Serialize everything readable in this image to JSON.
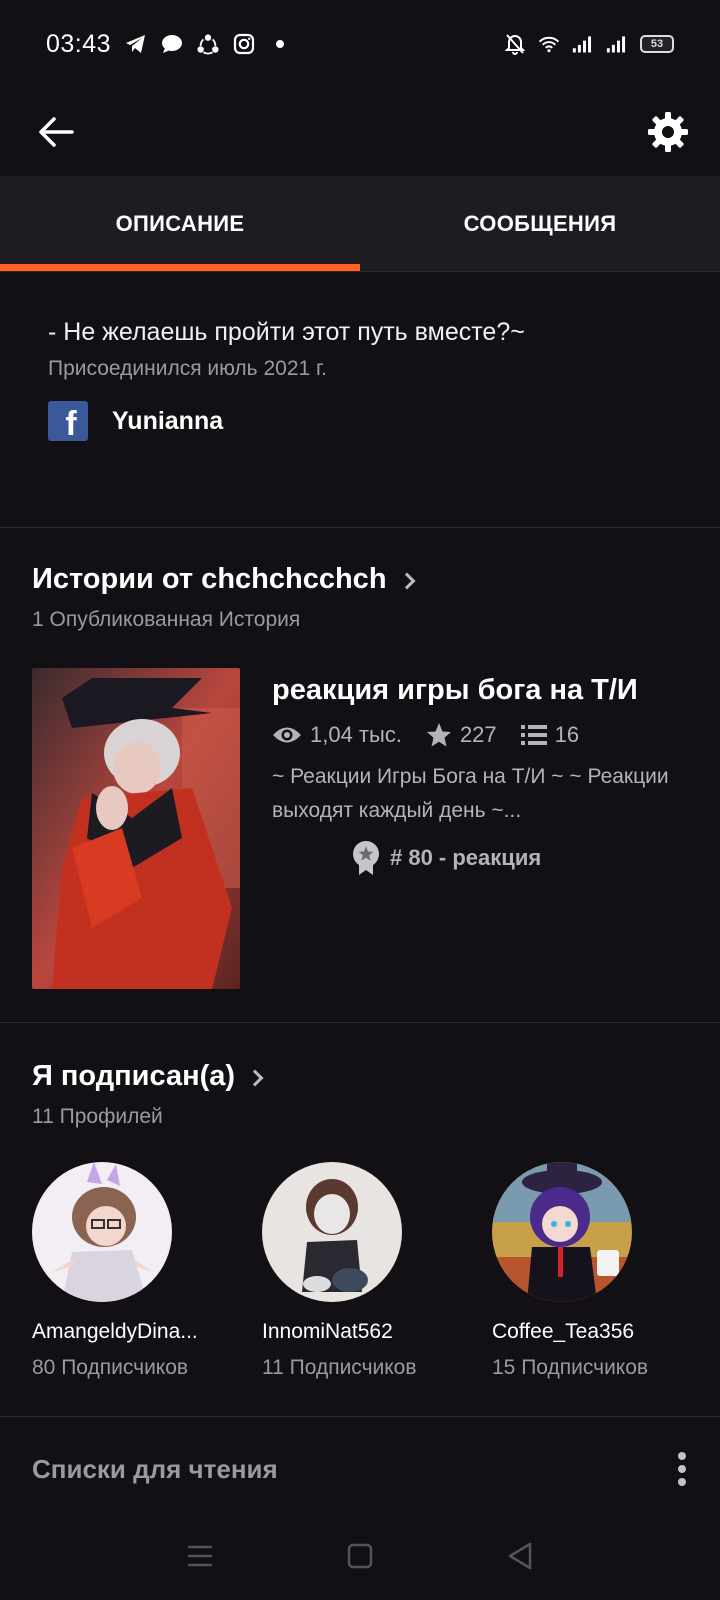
{
  "status_bar": {
    "time": "03:43",
    "battery": "53"
  },
  "tabs": [
    {
      "label": "ОПИСАНИЕ",
      "active": true
    },
    {
      "label": "СООБЩЕНИЯ",
      "active": false
    }
  ],
  "about": {
    "tagline": "- Не желаешь пройти этот путь вместе?~",
    "joined": "Присоединился июль 2021 г.",
    "facebook_name": "Yunianna"
  },
  "stories_section": {
    "title": "Истории от chchchcchch",
    "subtitle": "1 Опубликованная История",
    "story": {
      "title": "реакция игры бога на Т/И",
      "reads": "1,04 тыс.",
      "votes": "227",
      "parts": "16",
      "description": "~ Реакции Игры Бога на Т/И ~ ~ Реакции выходят каждый день ~...",
      "rank": "# 80 - реакция"
    }
  },
  "following_section": {
    "title": "Я подписан(а)",
    "subtitle": "11 Профилей",
    "profiles": [
      {
        "name": "AmangeldyDina...",
        "followers": "80 Подписчиков"
      },
      {
        "name": "InnomiNat562",
        "followers": "11 Подписчиков"
      },
      {
        "name": "Coffee_Tea356",
        "followers": "15 Подписчиков"
      }
    ]
  },
  "reading_lists": {
    "title": "Списки для чтения"
  },
  "colors": {
    "background": "#121015",
    "tab_bar": "#1e1c21",
    "accent": "#ff6122",
    "muted_text": "#9c9aa0"
  }
}
